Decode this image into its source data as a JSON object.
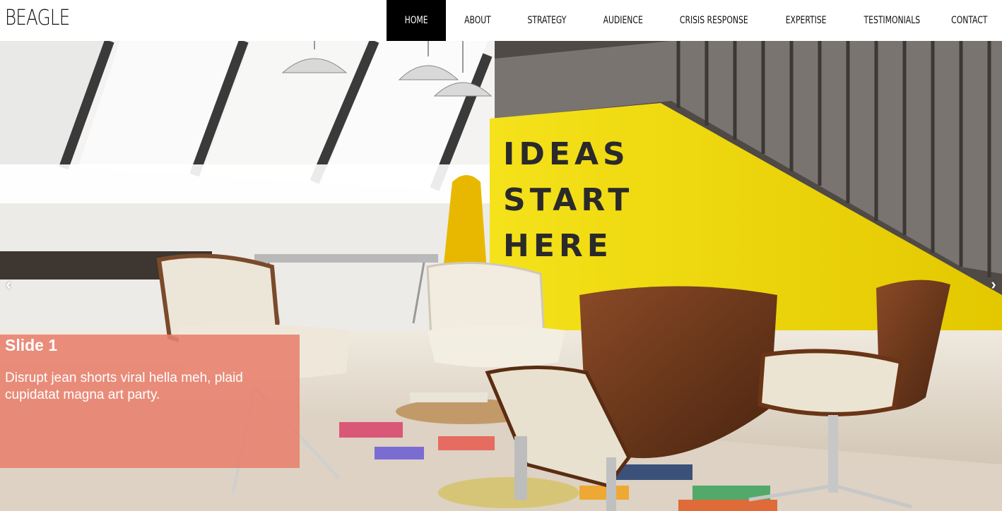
{
  "brand": "BEAGLE",
  "nav": [
    {
      "label": "HOME",
      "active": true
    },
    {
      "label": "ABOUT",
      "active": false
    },
    {
      "label": "STRATEGY",
      "active": false
    },
    {
      "label": "AUDIENCE",
      "active": false
    },
    {
      "label": "CRISIS RESPONSE",
      "active": false
    },
    {
      "label": "EXPERTISE",
      "active": false
    },
    {
      "label": "TESTIMONIALS",
      "active": false
    },
    {
      "label": "CONTACT",
      "active": false
    }
  ],
  "slide": {
    "title": "Slide 1",
    "text": "Disrupt jean shorts viral hella meh, plaid cupidatat magna art party.",
    "wall_sign": [
      "IDEAS",
      "START",
      "HERE"
    ]
  },
  "carousel": {
    "prev_icon": "‹",
    "next_icon": "›"
  },
  "colors": {
    "caption_bg": "#e8806c",
    "nav_active_bg": "#000000",
    "wall_yellow": "#f2dc0a"
  }
}
